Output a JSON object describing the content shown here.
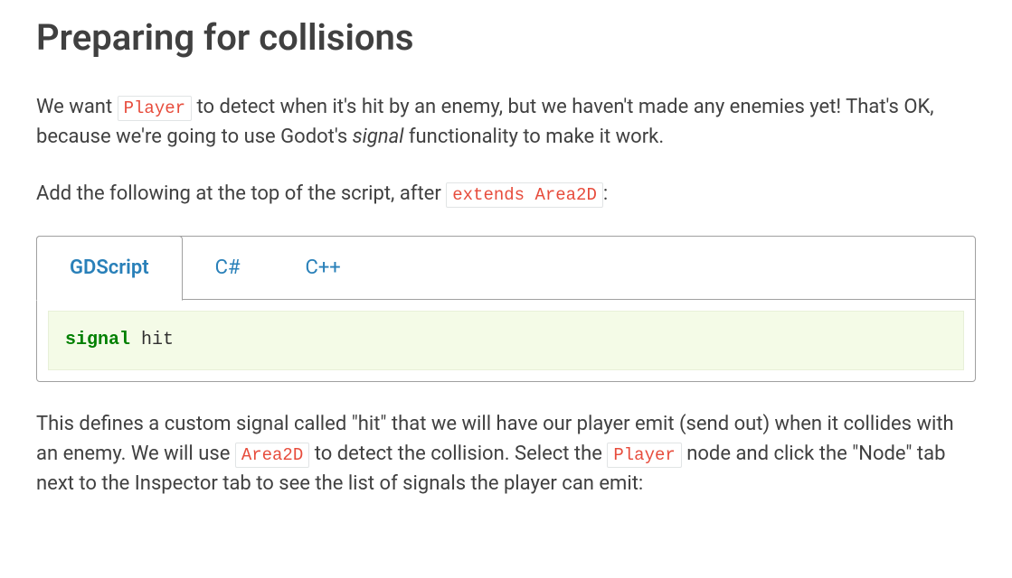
{
  "heading": "Preparing for collisions",
  "para1": {
    "pre": "We want ",
    "code1": "Player",
    "mid1": " to detect when it's hit by an enemy, but we haven't made any enemies yet! That's OK, because we're going to use Godot's ",
    "em": "signal",
    "post": " functionality to make it work."
  },
  "para2": {
    "pre": "Add the following at the top of the script, after ",
    "code1": "extends Area2D",
    "post": ":"
  },
  "tabs": {
    "t1": "GDScript",
    "t2": "C#",
    "t3": "C++"
  },
  "code": {
    "keyword": "signal",
    "identifier": " hit"
  },
  "para3": {
    "pre": "This defines a custom signal called \"hit\" that we will have our player emit (send out) when it collides with an enemy. We will use ",
    "code1": "Area2D",
    "mid1": " to detect the collision. Select the ",
    "code2": "Player",
    "post": " node and click the \"Node\" tab next to the Inspector tab to see the list of signals the player can emit:"
  }
}
